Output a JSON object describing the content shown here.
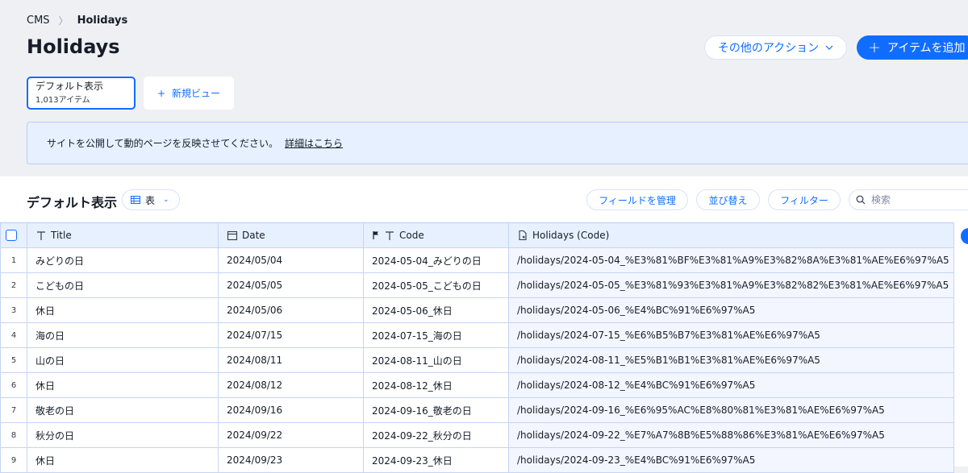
{
  "breadcrumb": {
    "root": "CMS",
    "current": "Holidays"
  },
  "page_title": "Holidays",
  "actions": {
    "more_label": "その他のアクション",
    "add_label": "アイテムを追加"
  },
  "views": {
    "active": {
      "name": "デフォルト表示",
      "count": "1,013アイテム"
    },
    "new_view_label": "新規ビュー"
  },
  "notice": {
    "text": "サイトを公開して動的ページを反映させてください。",
    "link": "詳細はこちら"
  },
  "toolbar": {
    "title": "デフォルト表示",
    "view_mode": "表",
    "manage_fields": "フィールドを管理",
    "sort": "並び替え",
    "filter": "フィルター",
    "search_placeholder": "検索"
  },
  "table": {
    "columns": [
      "Title",
      "Date",
      "Code",
      "Holidays (Code)"
    ],
    "rows": [
      {
        "n": "1",
        "title": "みどりの日",
        "date": "2024/05/04",
        "code": "2024-05-04_みどりの日",
        "path": "/holidays/2024-05-04_%E3%81%BF%E3%81%A9%E3%82%8A%E3%81%AE%E6%97%A5"
      },
      {
        "n": "2",
        "title": "こどもの日",
        "date": "2024/05/05",
        "code": "2024-05-05_こどもの日",
        "path": "/holidays/2024-05-05_%E3%81%93%E3%81%A9%E3%82%82%E3%81%AE%E6%97%A5"
      },
      {
        "n": "3",
        "title": "休日",
        "date": "2024/05/06",
        "code": "2024-05-06_休日",
        "path": "/holidays/2024-05-06_%E4%BC%91%E6%97%A5"
      },
      {
        "n": "4",
        "title": "海の日",
        "date": "2024/07/15",
        "code": "2024-07-15_海の日",
        "path": "/holidays/2024-07-15_%E6%B5%B7%E3%81%AE%E6%97%A5"
      },
      {
        "n": "5",
        "title": "山の日",
        "date": "2024/08/11",
        "code": "2024-08-11_山の日",
        "path": "/holidays/2024-08-11_%E5%B1%B1%E3%81%AE%E6%97%A5"
      },
      {
        "n": "6",
        "title": "休日",
        "date": "2024/08/12",
        "code": "2024-08-12_休日",
        "path": "/holidays/2024-08-12_%E4%BC%91%E6%97%A5"
      },
      {
        "n": "7",
        "title": "敬老の日",
        "date": "2024/09/16",
        "code": "2024-09-16_敬老の日",
        "path": "/holidays/2024-09-16_%E6%95%AC%E8%80%81%E3%81%AE%E6%97%A5"
      },
      {
        "n": "8",
        "title": "秋分の日",
        "date": "2024/09/22",
        "code": "2024-09-22_秋分の日",
        "path": "/holidays/2024-09-22_%E7%A7%8B%E5%88%86%E3%81%AE%E6%97%A5"
      },
      {
        "n": "9",
        "title": "休日",
        "date": "2024/09/23",
        "code": "2024-09-23_休日",
        "path": "/holidays/2024-09-23_%E4%BC%91%E6%97%A5"
      }
    ]
  },
  "colors": {
    "accent": "#116dff",
    "header_bg": "#e7f0ff",
    "page_bg": "#eff0f3"
  }
}
